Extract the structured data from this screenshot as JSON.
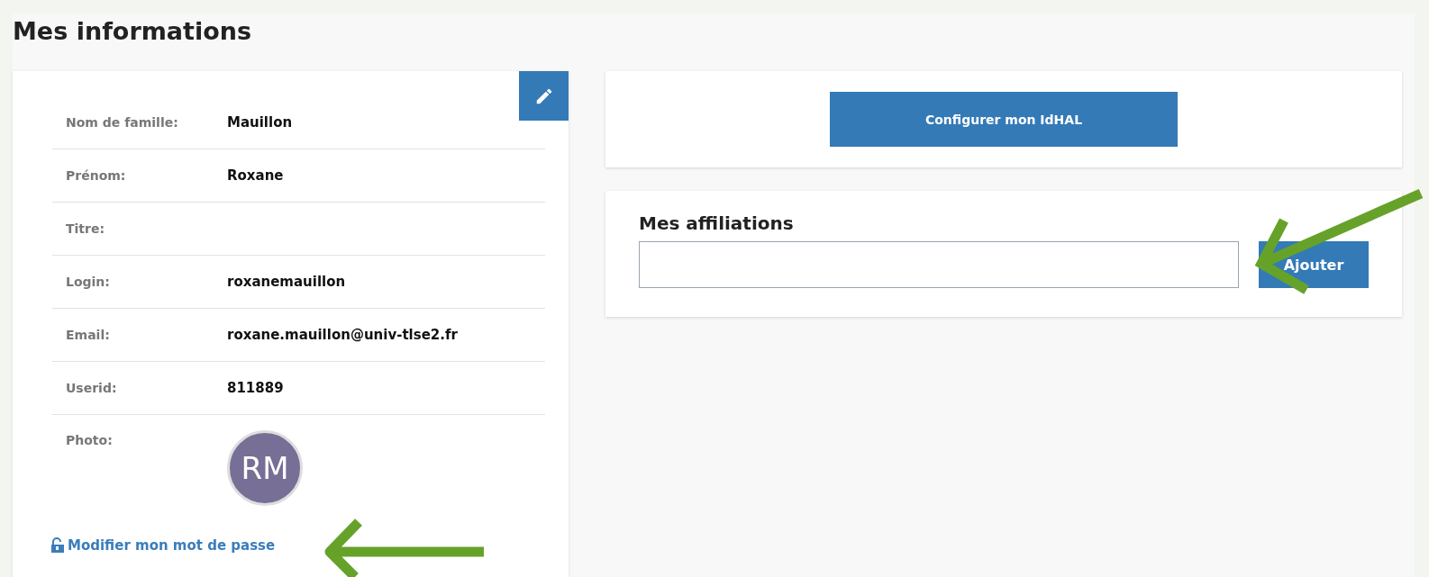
{
  "title": "Mes informations",
  "profile": {
    "fields": [
      {
        "label": "Nom de famille:",
        "value": "Mauillon"
      },
      {
        "label": "Prénom:",
        "value": "Roxane"
      },
      {
        "label": "Titre:"
      },
      {
        "label": "Login:",
        "value": "roxanemauillon"
      },
      {
        "label": "Email:",
        "value": "roxane.mauillon@univ-tlse2.fr"
      },
      {
        "label": "Userid:",
        "value": "811889"
      }
    ],
    "photo": {
      "label": "Photo:",
      "initials": "RM"
    },
    "password_link": "Modifier mon mot de passe"
  },
  "idhal_button": "Configurer mon IdHAL",
  "affiliations": {
    "title": "Mes affiliations",
    "add_button": "Ajouter"
  }
}
